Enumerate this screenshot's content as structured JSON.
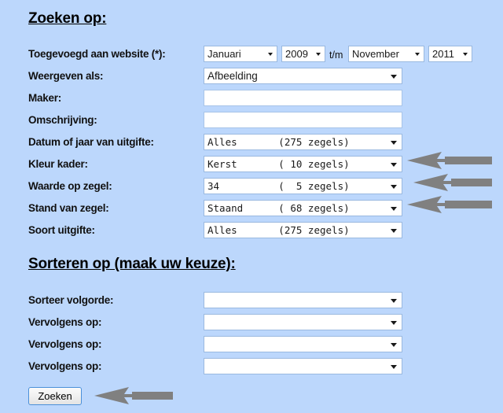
{
  "theme": {
    "background": "#bcd7fc",
    "field_background": "#ffffff",
    "field_border": "#9ab9e0",
    "arrow_color": "#808080",
    "text_color": "#111111",
    "button_border": "#4a90d9"
  },
  "sections": {
    "search": {
      "heading": "Zoeken op:",
      "rows": [
        {
          "label": "Toegevoegd aan website (*):",
          "type": "date-range",
          "from_month": "Januari",
          "from_year": "2009",
          "separator": "t/m",
          "to_month": "November",
          "to_year": "2011"
        },
        {
          "label": "Weergeven als:",
          "type": "select",
          "value": "Afbeelding"
        },
        {
          "label": "Maker:",
          "type": "text",
          "value": "",
          "placeholder": ""
        },
        {
          "label": "Omschrijving:",
          "type": "text",
          "value": "",
          "placeholder": ""
        },
        {
          "label": "Datum of jaar van uitgifte:",
          "type": "select-mono",
          "value": "Alles       (275 zegels)"
        },
        {
          "label": "Kleur kader:",
          "type": "select-mono",
          "value": "Kerst       ( 10 zegels)",
          "annotated": true
        },
        {
          "label": "Waarde op zegel:",
          "type": "select-mono",
          "value": "34          (  5 zegels)",
          "annotated": true
        },
        {
          "label": "Stand van zegel:",
          "type": "select-mono",
          "value": "Staand      ( 68 zegels)",
          "annotated": true
        },
        {
          "label": "Soort uitgifte:",
          "type": "select-mono",
          "value": "Alles       (275 zegels)"
        }
      ]
    },
    "sort": {
      "heading": "Sorteren op (maak uw keuze):",
      "rows": [
        {
          "label": "Sorteer volgorde:",
          "type": "select",
          "value": ""
        },
        {
          "label": "Vervolgens op:",
          "type": "select",
          "value": ""
        },
        {
          "label": "Vervolgens op:",
          "type": "select",
          "value": ""
        },
        {
          "label": "Vervolgens op:",
          "type": "select",
          "value": ""
        }
      ]
    }
  },
  "submit": {
    "label": "Zoeken"
  },
  "annotations": {
    "arrow_icon": "arrow-left-icon",
    "count": 4
  }
}
